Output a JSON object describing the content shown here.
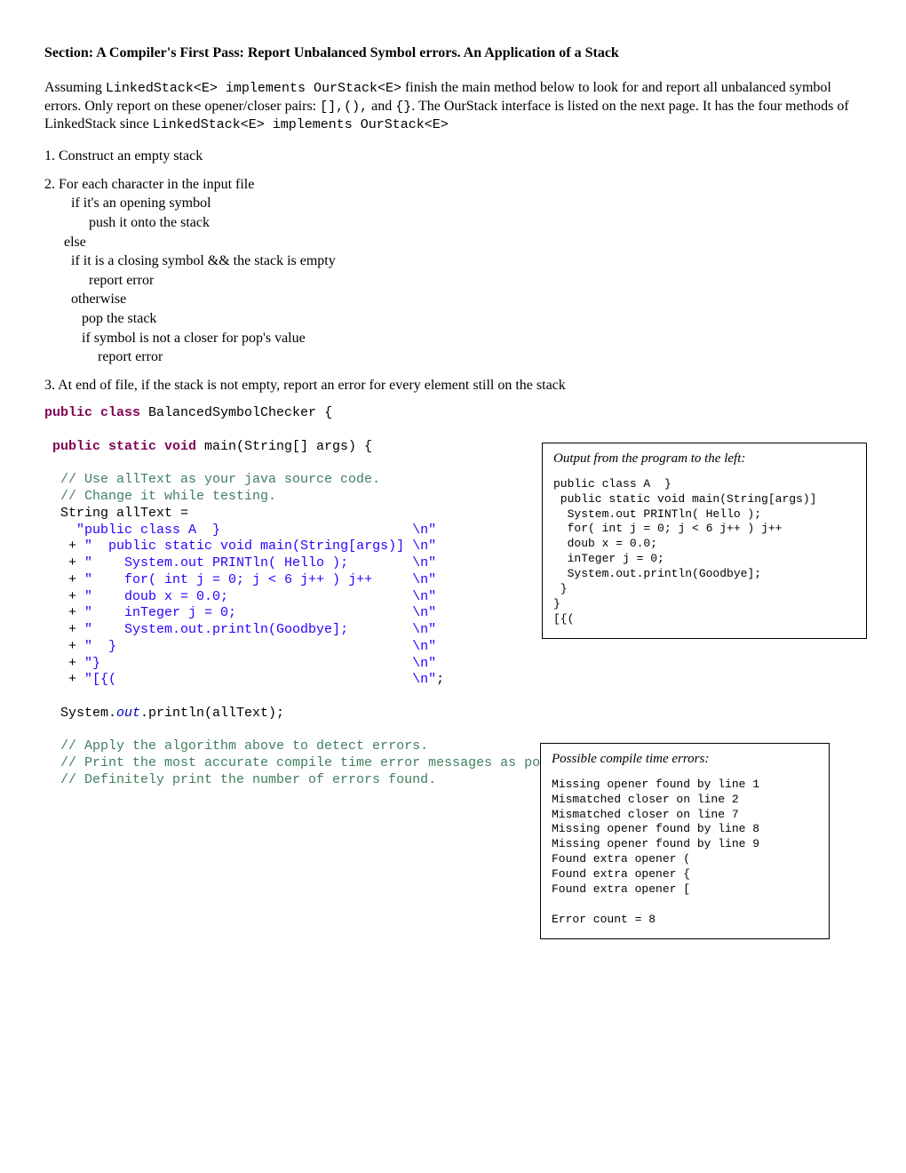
{
  "section_title": "Section:  A Compiler's First Pass: Report Unbalanced Symbol errors. An Application of a Stack",
  "intro": {
    "p1_a": "Assuming ",
    "p1_code1": "LinkedStack<E> implements OurStack<E>",
    "p1_b": "  finish the main method below to look for and report all unbalanced symbol errors.  Only report on these opener/closer pairs:  ",
    "p1_code2": "[],(),",
    "p1_c": " and ",
    "p1_code3": "{}",
    "p1_d": ".  The OurStack interface is listed on the next page. It has the four  methods of LinkedStack since ",
    "p1_code4": "LinkedStack<E> implements OurStack<E>"
  },
  "algo": {
    "step1": "1. Construct an empty stack",
    "step2": "2. For each character in the input file",
    "s2a": "if it's an opening symbol",
    "s2b": "push it onto the stack",
    "s2c": "else",
    "s2d": "if it is a closing symbol && the stack is empty",
    "s2e": "report error",
    "s2f": "otherwise",
    "s2g": "pop the stack",
    "s2h": "if symbol is not a closer for pop's value",
    "s2i": "report error",
    "step3": " 3. At end of file, if the stack is not empty, report an error for every element still on the stack"
  },
  "code": {
    "l1a": "public class",
    "l1b": " BalancedSymbolChecker {",
    "l2a": " public static void",
    "l2b": " main(String[] args) {",
    "c1": "  // Use allText as your java source code.",
    "c2": "  // Change it while testing.",
    "l3": "  String allText = ",
    "s0a": "    ",
    "s0b": "\"public class A  }                        \\n\"",
    "s1a": "   + ",
    "s1b": "\"  public static void main(String[args)] \\n\"",
    "s2a": "   + ",
    "s2b": "\"    System.out PRINTln( Hello );        \\n\"",
    "s3a": "   + ",
    "s3b": "\"    for( int j = 0; j < 6 j++ ) j++     \\n\"",
    "s4a": "   + ",
    "s4b": "\"    doub x = 0.0;                       \\n\"",
    "s5a": "   + ",
    "s5b": "\"    inTeger j = 0;                      \\n\"",
    "s6a": "   + ",
    "s6b": "\"    System.out.println(Goodbye];        \\n\"",
    "s7a": "   + ",
    "s7b": "\"  }                                     \\n\"",
    "s8a": "   + ",
    "s8b": "\"}                                       \\n\"",
    "s9a": "   + ",
    "s9b": "\"[{(                                     \\n\"",
    "s9c": ";",
    "p1a": "  System.",
    "p1b": "out",
    "p1c": ".println(allText);",
    "cc1": "  // Apply the algorithm above to detect errors.",
    "cc2": "  // Print the most accurate compile time error messages as possible.",
    "cc3": "  // Definitely print the number of errors found."
  },
  "outbox": {
    "title": "Output from the program to the left:",
    "content": "public class A  }\n public static void main(String[args)]\n  System.out PRINTln( Hello );\n  for( int j = 0; j < 6 j++ ) j++\n  doub x = 0.0;\n  inTeger j = 0;\n  System.out.println(Goodbye];\n }\n}\n[{("
  },
  "errbox": {
    "title": "Possible compile time errors:",
    "content": "Missing opener found by line 1\nMismatched closer on line 2\nMismatched closer on line 7\nMissing opener found by line 8\nMissing opener found by line 9\nFound extra opener (\nFound extra opener {\nFound extra opener [\n\nError count = 8"
  }
}
